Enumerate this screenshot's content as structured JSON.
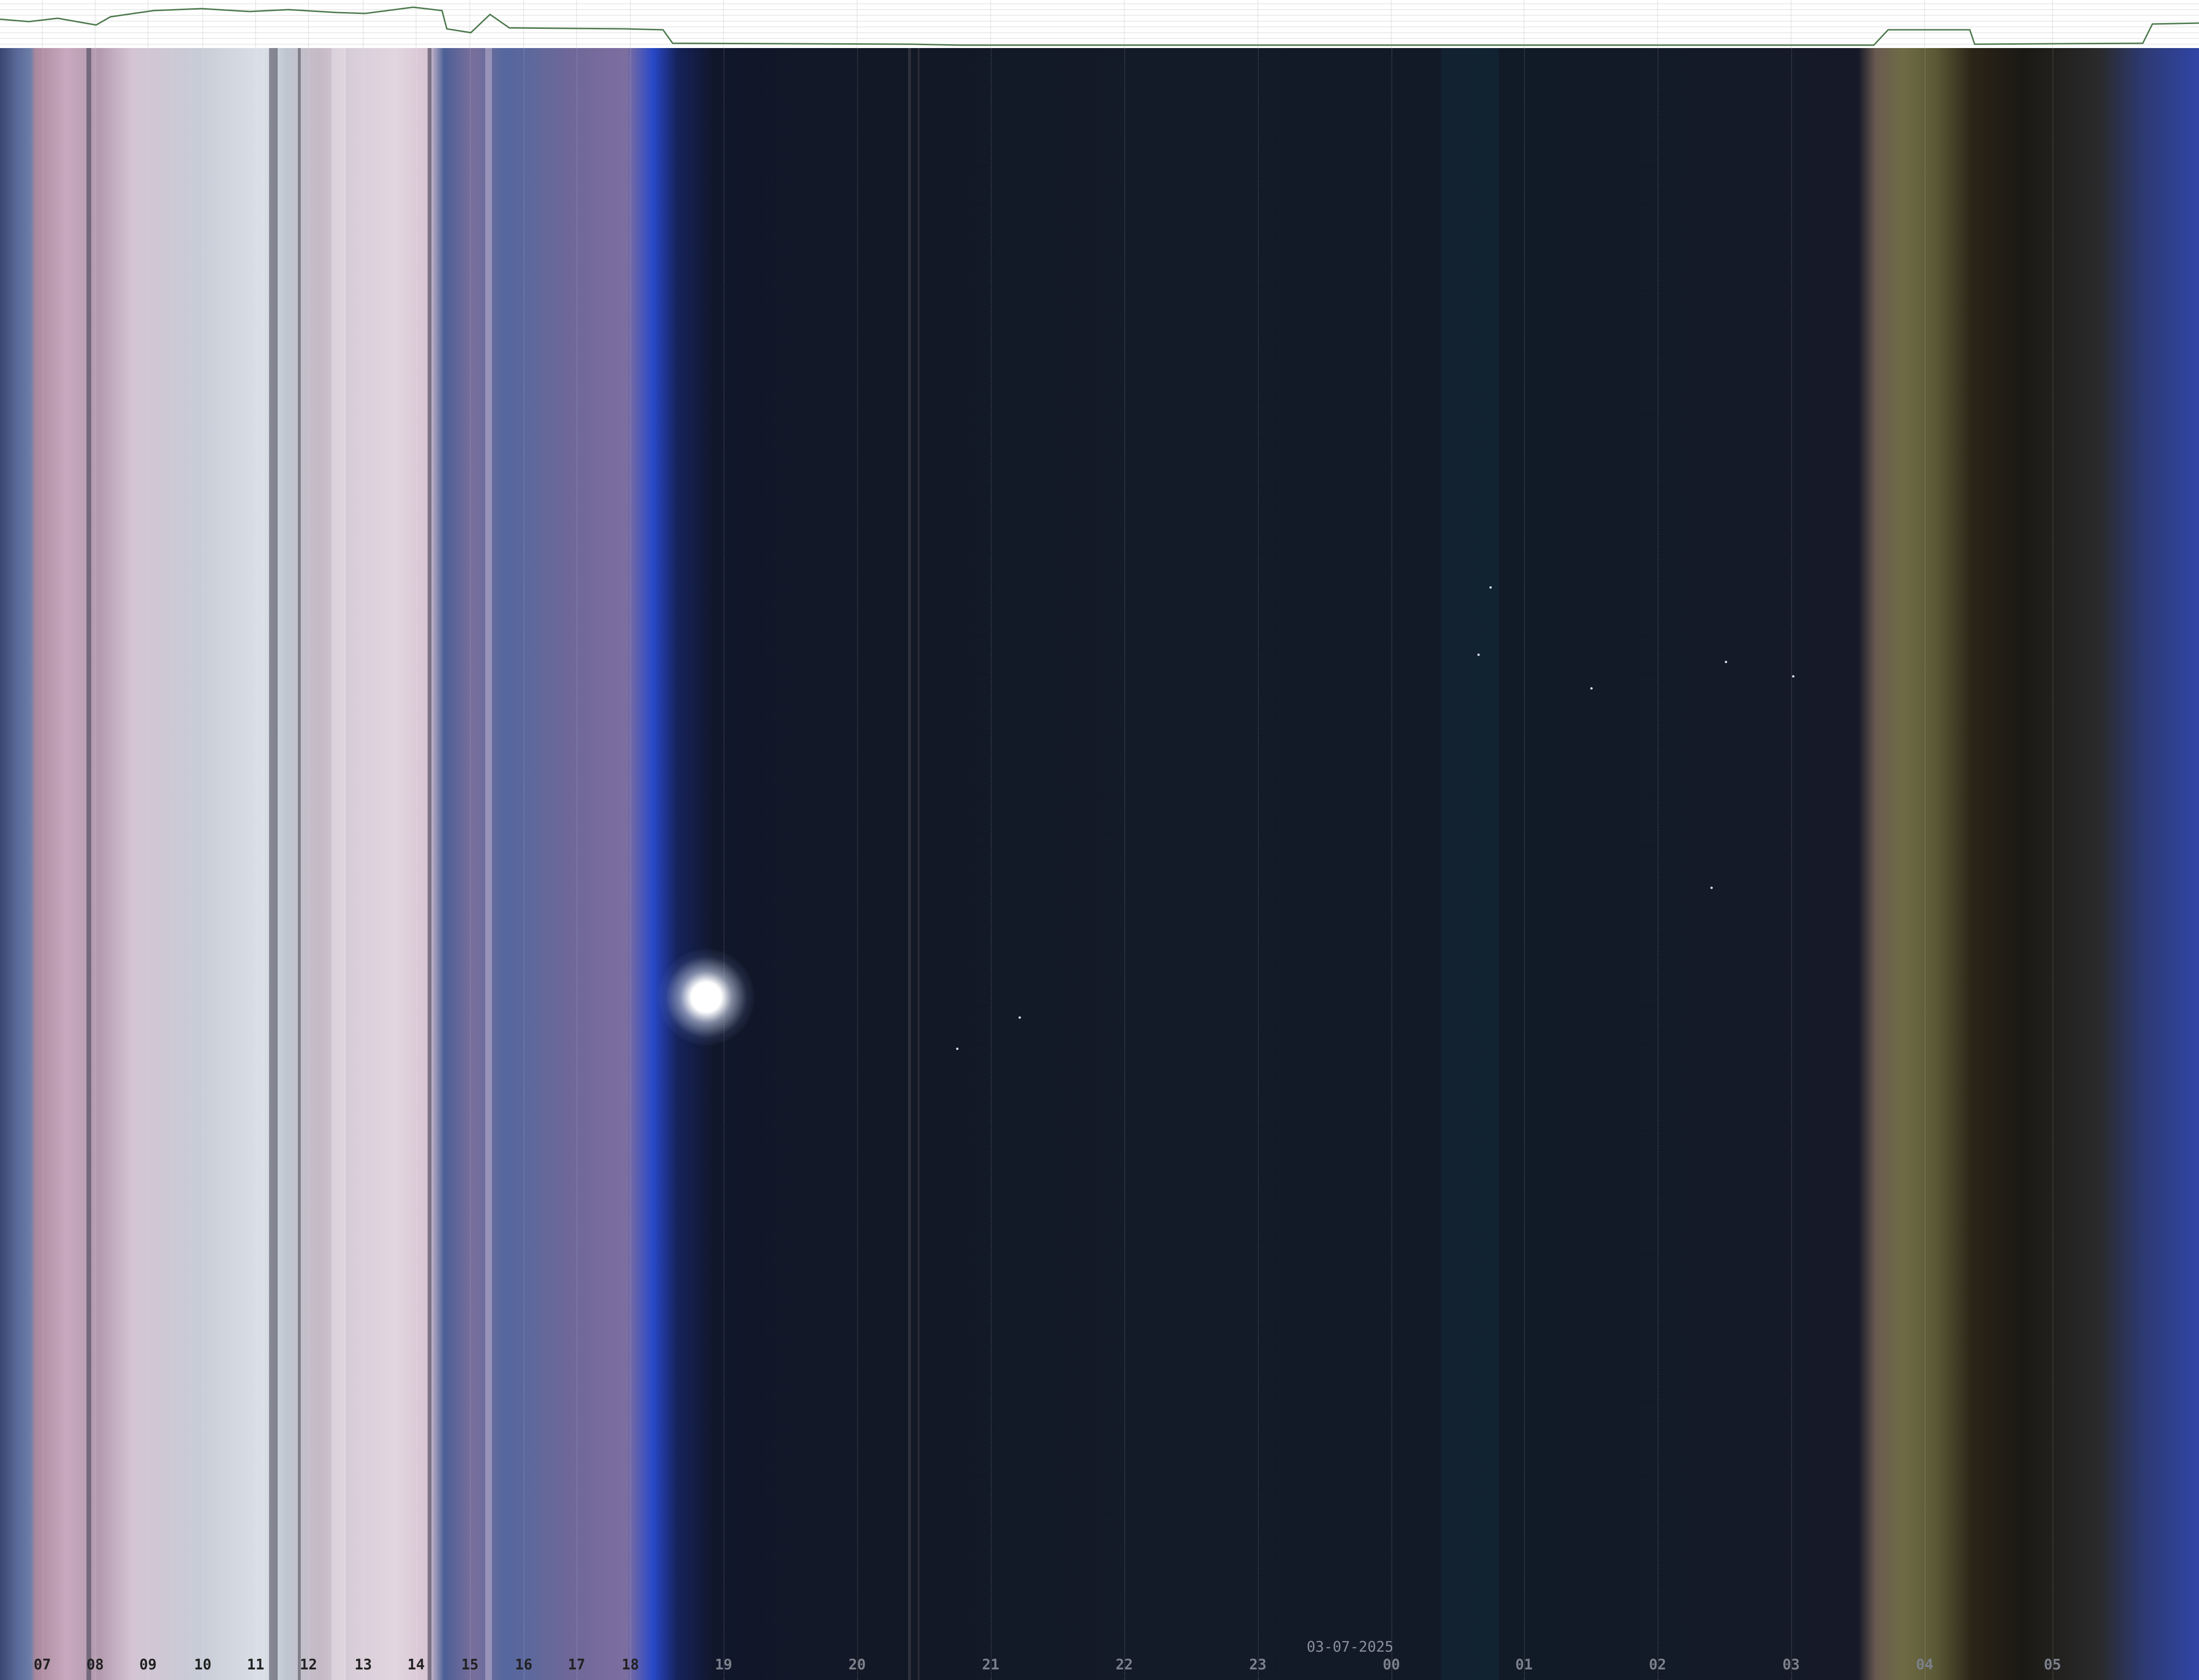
{
  "date_label": "03-07-2025",
  "hour_labels": [
    "07",
    "08",
    "09",
    "10",
    "11",
    "12",
    "13",
    "14",
    "15",
    "16",
    "17",
    "18",
    "19",
    "20",
    "21",
    "22",
    "23",
    "00",
    "01",
    "02",
    "03",
    "04",
    "05"
  ],
  "colors": {
    "day_label": "#222222",
    "night_label": "#7b808a",
    "trace_line": "#4e7a4e",
    "trace_grid": "#d8d8d8"
  }
}
